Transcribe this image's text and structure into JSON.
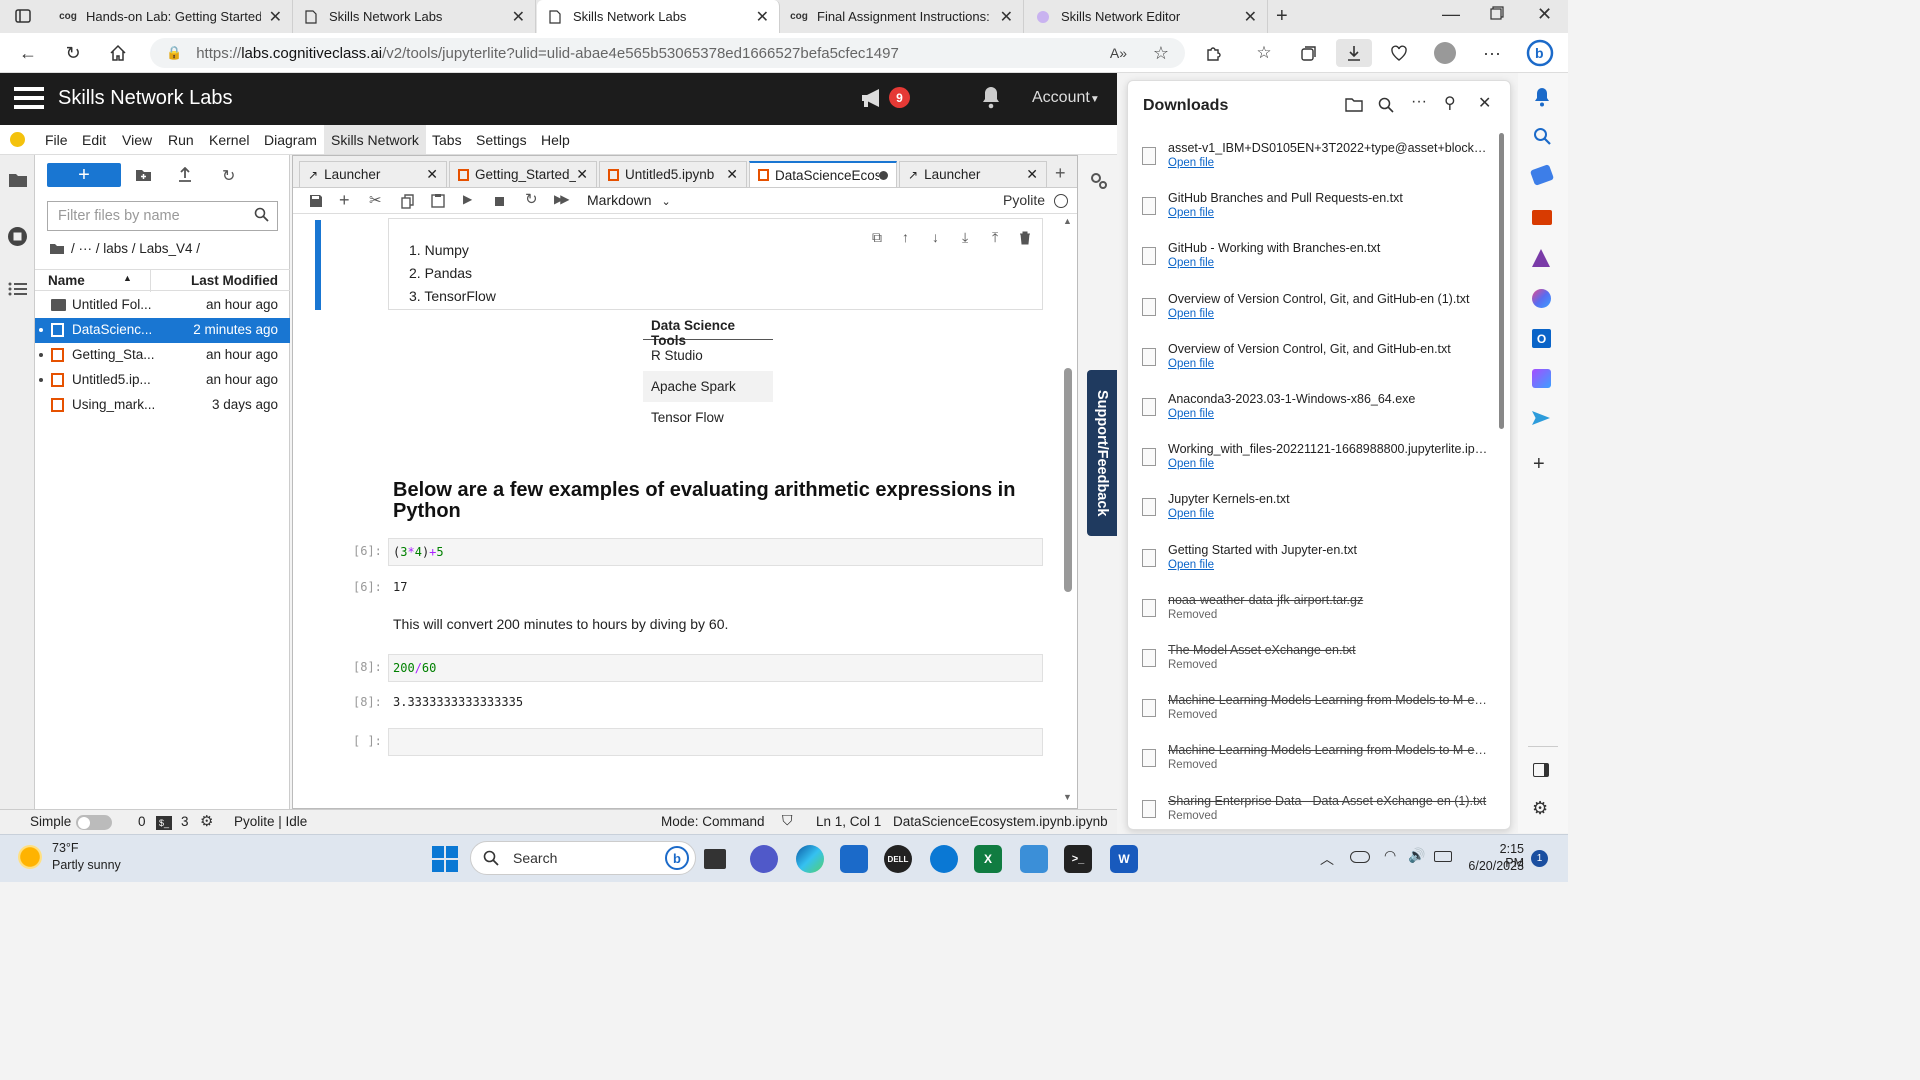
{
  "browser": {
    "tabs": [
      {
        "label": "Hands-on Lab: Getting Started w",
        "icon": "skills-network-logo-icon",
        "active": false
      },
      {
        "label": "Skills Network Labs",
        "icon": "page-icon",
        "active": false
      },
      {
        "label": "Skills Network Labs",
        "icon": "page-icon",
        "active": true
      },
      {
        "label": "Final Assignment Instructions: Cr",
        "icon": "skills-network-logo-icon",
        "active": false
      },
      {
        "label": "Skills Network Editor",
        "icon": "editor-icon",
        "active": false
      }
    ],
    "url_prefix": "https://",
    "url_host": "labs.cognitiveclass.ai",
    "url_path": "/v2/tools/jupyterlite?ulid=ulid-abae4e565b53065378ed1666527befa5cfec1497"
  },
  "jupyter": {
    "brand": "Skills Network Labs",
    "notification_count": "9",
    "account_label": "Account",
    "menu": [
      "File",
      "Edit",
      "View",
      "Run",
      "Kernel",
      "Diagram",
      "Skills Network",
      "Tabs",
      "Settings",
      "Help"
    ],
    "filter_placeholder": "Filter files by name",
    "breadcrumb": "/ ··· / labs / Labs_V4 /",
    "columns": {
      "name": "Name",
      "modified": "Last Modified"
    },
    "files": [
      {
        "name": "Untitled Fol...",
        "modified": "an hour ago",
        "type": "folder",
        "selected": false,
        "dot": false
      },
      {
        "name": "DataScienc...",
        "modified": "2 minutes ago",
        "type": "notebook",
        "selected": true,
        "dot": true
      },
      {
        "name": "Getting_Sta...",
        "modified": "an hour ago",
        "type": "notebook",
        "selected": false,
        "dot": true
      },
      {
        "name": "Untitled5.ip...",
        "modified": "an hour ago",
        "type": "notebook",
        "selected": false,
        "dot": true
      },
      {
        "name": "Using_mark...",
        "modified": "3 days ago",
        "type": "notebook",
        "selected": false,
        "dot": false
      }
    ],
    "nb_tabs": [
      {
        "label": "Launcher",
        "active": false
      },
      {
        "label": "Getting_Started_w",
        "active": false
      },
      {
        "label": "Untitled5.ipynb",
        "active": false
      },
      {
        "label": "DataScienceEcos",
        "active": true
      },
      {
        "label": "Launcher",
        "active": false
      }
    ],
    "cell_type": "Markdown",
    "kernel": "Pyolite",
    "list_items": [
      "Numpy",
      "Pandas",
      "TensorFlow"
    ],
    "tools_table": {
      "header": "Data Science Tools",
      "rows": [
        "R Studio",
        "Apache Spark",
        "Tensor Flow"
      ]
    },
    "heading": "Below are a few examples of evaluating arithmetic expressions in Python",
    "cell6_prompt": "[6]:",
    "cell6_code": {
      "p1": "(",
      "n1": "3",
      "op1": "*",
      "n2": "4",
      "p2": ")",
      "op2": "+",
      "n3": "5"
    },
    "cell6_out_prompt": "[6]:",
    "cell6_out": "17",
    "convert_text": "This will convert 200 minutes to hours by diving by 60.",
    "cell8_prompt": "[8]:",
    "cell8_code": {
      "n1": "200",
      "op": "/",
      "n2": "60"
    },
    "cell8_out_prompt": "[8]:",
    "cell8_out": "3.3333333333333335",
    "empty_prompt": "[ ]:",
    "support_label": "Support/Feedback",
    "status": {
      "simple": "Simple",
      "count0": "0",
      "count3": "3",
      "kernel_status": "Pyolite | Idle",
      "mode": "Mode: Command",
      "position": "Ln 1, Col 1",
      "filename": "DataScienceEcosystem.ipynb.ipynb"
    }
  },
  "downloads": {
    "title": "Downloads",
    "items": [
      {
        "name": "asset-v1_IBM+DS0105EN+3T2022+type@asset+block@...",
        "sub": "Open file",
        "removed": false
      },
      {
        "name": "GitHub Branches and Pull Requests-en.txt",
        "sub": "Open file",
        "removed": false
      },
      {
        "name": "GitHub - Working with Branches-en.txt",
        "sub": "Open file",
        "removed": false
      },
      {
        "name": "Overview of Version Control, Git, and GitHub-en (1).txt",
        "sub": "Open file",
        "removed": false
      },
      {
        "name": "Overview of Version Control, Git, and GitHub-en.txt",
        "sub": "Open file",
        "removed": false
      },
      {
        "name": "Anaconda3-2023.03-1-Windows-x86_64.exe",
        "sub": "Open file",
        "removed": false
      },
      {
        "name": "Working_with_files-20221121-1668988800.jupyterlite.ipynb",
        "sub": "Open file",
        "removed": false
      },
      {
        "name": "Jupyter Kernels-en.txt",
        "sub": "Open file",
        "removed": false
      },
      {
        "name": "Getting Started with Jupyter-en.txt",
        "sub": "Open file",
        "removed": false
      },
      {
        "name": "noaa-weather-data-jfk-airport.tar.gz",
        "sub": "Removed",
        "removed": true
      },
      {
        "name": "The Model Asset eXchange-en.txt",
        "sub": "Removed",
        "removed": true
      },
      {
        "name": "Machine Learning Models Learning from Models to M-en...",
        "sub": "Removed",
        "removed": true
      },
      {
        "name": "Machine Learning Models Learning from Models to M-en...",
        "sub": "Removed",
        "removed": true
      },
      {
        "name": "Sharing Enterprise Data - Data Asset eXchange-en (1).txt",
        "sub": "Removed",
        "removed": true
      }
    ]
  },
  "taskbar": {
    "weather_temp": "73°F",
    "weather_desc": "Partly sunny",
    "search_label": "Search",
    "time": "2:15 PM",
    "date": "6/20/2023",
    "notif_count": "1"
  },
  "colors": {
    "accent": "#1976d2",
    "jupyter_header": "#1c1c1c",
    "notif_red": "#e53935",
    "code_green": "#008000",
    "code_purple": "#aa22ff"
  }
}
